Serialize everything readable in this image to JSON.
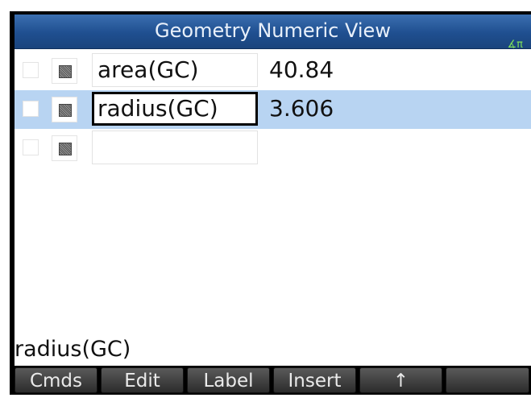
{
  "header": {
    "title": "Geometry Numeric View",
    "angle_indicator": "∡π"
  },
  "rows": [
    {
      "expression": "area(GC)",
      "value": "40.84",
      "selected": false
    },
    {
      "expression": "radius(GC)",
      "value": "3.606",
      "selected": true
    },
    {
      "expression": "",
      "value": "",
      "selected": false
    }
  ],
  "command_line": "radius(GC)",
  "menu": {
    "cmds": "Cmds",
    "edit": "Edit",
    "label": "Label",
    "insert": "Insert",
    "up_arrow": "↑",
    "blank": ""
  },
  "colors": {
    "title_bar": "#1f4f90",
    "selected_row": "#b8d4f2",
    "menu_bar": "#000000"
  }
}
